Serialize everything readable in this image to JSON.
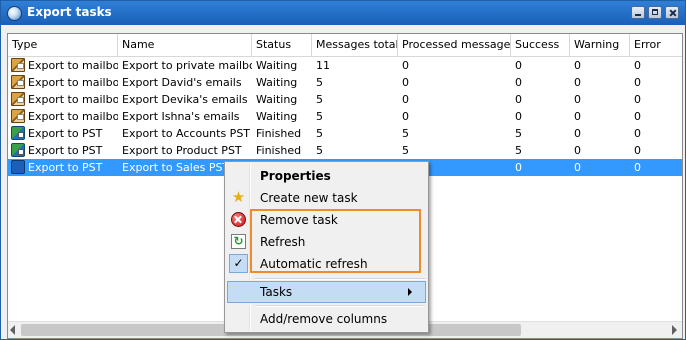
{
  "window": {
    "title": "Export tasks",
    "app_icon": "globe-icon",
    "controls": [
      "minimize-icon",
      "maximize-icon",
      "close-icon"
    ]
  },
  "list": {
    "columns": [
      "Type",
      "Name",
      "Status",
      "Messages total",
      "Processed messages",
      "Success",
      "Warning",
      "Error"
    ],
    "rows": [
      {
        "type": "Export to mailbox",
        "name": "Export to private mailbox",
        "status": "Waiting",
        "total": "11",
        "processed": "0",
        "success": "0",
        "warning": "0",
        "error": "0",
        "icon": "mailbox-icon"
      },
      {
        "type": "Export to mailbox",
        "name": "Export David's emails",
        "status": "Waiting",
        "total": "5",
        "processed": "0",
        "success": "0",
        "warning": "0",
        "error": "0",
        "icon": "mailbox-icon"
      },
      {
        "type": "Export to mailbox",
        "name": "Export Devika's emails",
        "status": "Waiting",
        "total": "5",
        "processed": "0",
        "success": "0",
        "warning": "0",
        "error": "0",
        "icon": "mailbox-icon"
      },
      {
        "type": "Export to mailbox",
        "name": "Export Ishna's emails",
        "status": "Waiting",
        "total": "5",
        "processed": "0",
        "success": "0",
        "warning": "0",
        "error": "0",
        "icon": "mailbox-icon"
      },
      {
        "type": "Export to PST",
        "name": "Export to Accounts PST",
        "status": "Finished",
        "total": "5",
        "processed": "5",
        "success": "5",
        "warning": "0",
        "error": "0",
        "icon": "pst-icon"
      },
      {
        "type": "Export to PST",
        "name": "Export to Product PST",
        "status": "Finished",
        "total": "5",
        "processed": "5",
        "success": "5",
        "warning": "0",
        "error": "0",
        "icon": "pst-icon"
      },
      {
        "type": "Export to PST",
        "name": "Export to Sales PST",
        "status": "",
        "total": "",
        "processed": "",
        "success": "0",
        "warning": "0",
        "error": "0",
        "icon": "pst-icon",
        "selected": true
      }
    ]
  },
  "context_menu": {
    "properties": "Properties",
    "create_new_task": "Create new task",
    "remove_task": "Remove task",
    "refresh": "Refresh",
    "automatic_refresh": "Automatic refresh",
    "automatic_refresh_checked": true,
    "tasks": "Tasks",
    "add_remove_columns": "Add/remove columns",
    "check_mark": "✓"
  },
  "colors": {
    "selection": "#3399ff",
    "highlight_box": "#f08b2a",
    "title_bar": "#1a5fb8"
  }
}
